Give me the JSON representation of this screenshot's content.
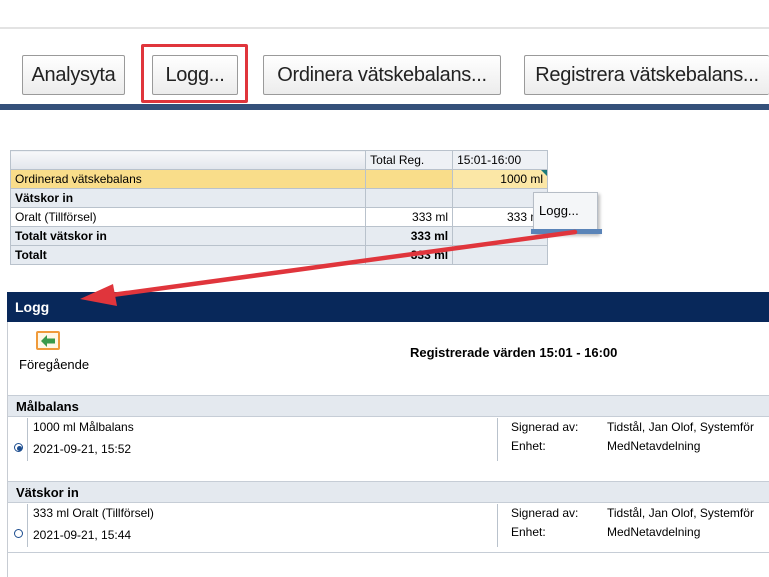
{
  "toolbar": {
    "buttons": [
      {
        "label": "Analysyta"
      },
      {
        "label": "Logg..."
      },
      {
        "label": "Ordinera vätskebalans..."
      },
      {
        "label": "Registrera vätskebalans..."
      }
    ]
  },
  "grid": {
    "headers": {
      "total": "Total Reg.",
      "period": "15:01-16:00"
    },
    "rows": [
      {
        "label": "Ordinerad vätskebalans",
        "total": "",
        "period": "1000 ml"
      },
      {
        "label": "Vätskor in",
        "total": "",
        "period": ""
      },
      {
        "label": "Oralt (Tillförsel)",
        "total": "333 ml",
        "period": "333 ml"
      },
      {
        "label": "Totalt vätskor in",
        "total": "333 ml",
        "period": ""
      },
      {
        "label": "Totalt",
        "total": "333 ml",
        "period": ""
      }
    ]
  },
  "context_menu": {
    "item": "Logg..."
  },
  "log": {
    "header": "Logg",
    "prev_label": "Föregående",
    "title": "Registrerade värden 15:01 - 16:00",
    "sections": [
      {
        "title": "Målbalans",
        "entry": {
          "value": "1000 ml Målbalans",
          "datetime": "2021-09-21, 15:52",
          "signed_label": "Signerad av:",
          "signed_value": "Tidstål, Jan Olof, Systemför",
          "unit_label": "Enhet:",
          "unit_value": "MedNetavdelning",
          "selected": true
        }
      },
      {
        "title": "Vätskor in",
        "entry": {
          "value": "333 ml Oralt (Tillförsel)",
          "datetime": "2021-09-21, 15:44",
          "signed_label": "Signerad av:",
          "signed_value": "Tidstål, Jan Olof, Systemför",
          "unit_label": "Enhet:",
          "unit_value": "MedNetavdelning",
          "selected": false
        }
      }
    ]
  },
  "colors": {
    "highlight": "#e0353c",
    "arrow": "#e0353c",
    "log_header": "#08285a",
    "toolbar_bar": "#34507a"
  },
  "icons": {
    "prev": "arrow-left-icon"
  }
}
